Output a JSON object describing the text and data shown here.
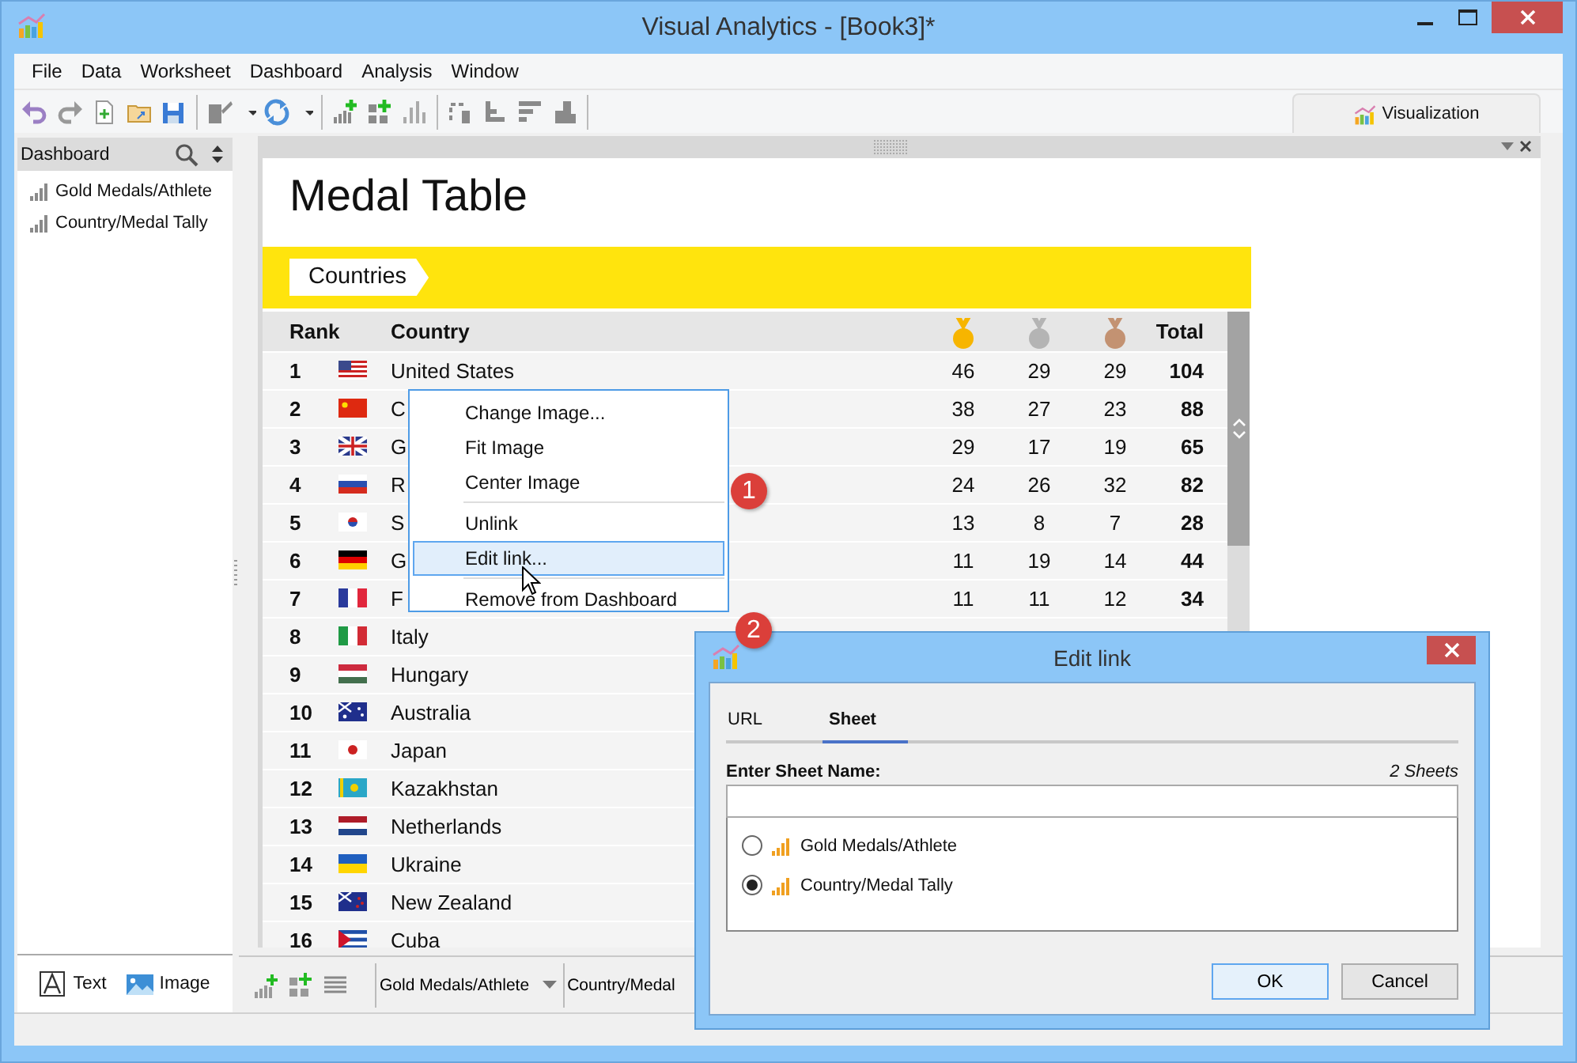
{
  "window": {
    "title": "Visual Analytics - [Book3]*"
  },
  "menu": [
    "File",
    "Data",
    "Worksheet",
    "Dashboard",
    "Analysis",
    "Window"
  ],
  "view_tab": {
    "label": "Visualization"
  },
  "sidebar": {
    "title": "Dashboard",
    "items": [
      "Gold Medals/Athlete",
      "Country/Medal Tally"
    ],
    "objects": [
      {
        "kind": "text",
        "label": "Text"
      },
      {
        "kind": "image",
        "label": "Image"
      }
    ]
  },
  "dashboard": {
    "title": "Medal Table",
    "section": "Countries",
    "columns": {
      "rank": "Rank",
      "country": "Country",
      "total": "Total"
    },
    "rows": [
      {
        "rank": "1",
        "kind": "us",
        "country": "United States",
        "gold": "46",
        "silver": "29",
        "bronze": "29",
        "total": "104"
      },
      {
        "rank": "2",
        "kind": "cn",
        "country": "C",
        "gold": "38",
        "silver": "27",
        "bronze": "23",
        "total": "88"
      },
      {
        "rank": "3",
        "kind": "gb",
        "country": "G",
        "gold": "29",
        "silver": "17",
        "bronze": "19",
        "total": "65"
      },
      {
        "rank": "4",
        "kind": "ru",
        "country": "R",
        "gold": "24",
        "silver": "26",
        "bronze": "32",
        "total": "82"
      },
      {
        "rank": "5",
        "kind": "kr",
        "country": "S",
        "gold": "13",
        "silver": "8",
        "bronze": "7",
        "total": "28"
      },
      {
        "rank": "6",
        "kind": "de",
        "country": "G",
        "gold": "11",
        "silver": "19",
        "bronze": "14",
        "total": "44"
      },
      {
        "rank": "7",
        "kind": "fr",
        "country": "F",
        "gold": "11",
        "silver": "11",
        "bronze": "12",
        "total": "34"
      },
      {
        "rank": "8",
        "kind": "it",
        "country": "Italy"
      },
      {
        "rank": "9",
        "kind": "hu",
        "country": "Hungary"
      },
      {
        "rank": "10",
        "kind": "au",
        "country": "Australia"
      },
      {
        "rank": "11",
        "kind": "jp",
        "country": "Japan"
      },
      {
        "rank": "12",
        "kind": "kz",
        "country": "Kazakhstan"
      },
      {
        "rank": "13",
        "kind": "nl",
        "country": "Netherlands"
      },
      {
        "rank": "14",
        "kind": "ua",
        "country": "Ukraine"
      },
      {
        "rank": "15",
        "kind": "nz",
        "country": "New Zealand"
      },
      {
        "rank": "16",
        "kind": "cu",
        "country": "Cuba"
      }
    ]
  },
  "sheet_tabs": [
    {
      "label": "Gold Medals/Athlete",
      "dropdown": true
    },
    {
      "label": "Country/Medal",
      "dropdown": false
    }
  ],
  "context_menu": {
    "items": [
      {
        "kind": "item",
        "label": "Change Image...",
        "selected": false
      },
      {
        "kind": "item",
        "label": "Fit Image",
        "selected": false
      },
      {
        "kind": "item",
        "label": "Center Image",
        "selected": false
      },
      {
        "kind": "separator"
      },
      {
        "kind": "item",
        "label": "Unlink",
        "selected": false
      },
      {
        "kind": "item",
        "label": "Edit link...",
        "selected": true
      },
      {
        "kind": "separator"
      },
      {
        "kind": "item",
        "label": "Remove from Dashboard",
        "selected": false
      }
    ]
  },
  "badges": [
    "1",
    "2"
  ],
  "dialog": {
    "title": "Edit link",
    "tabs": [
      {
        "label": "URL",
        "selected": false
      },
      {
        "label": "Sheet",
        "selected": true
      }
    ],
    "field_label": "Enter Sheet Name:",
    "count": "2 Sheets",
    "options": [
      {
        "label": "Gold Medals/Athlete",
        "selected": false
      },
      {
        "label": "Country/Medal Tally",
        "selected": true
      }
    ],
    "buttons": [
      {
        "label": "OK",
        "default": true
      },
      {
        "label": "Cancel",
        "default": false
      }
    ]
  }
}
